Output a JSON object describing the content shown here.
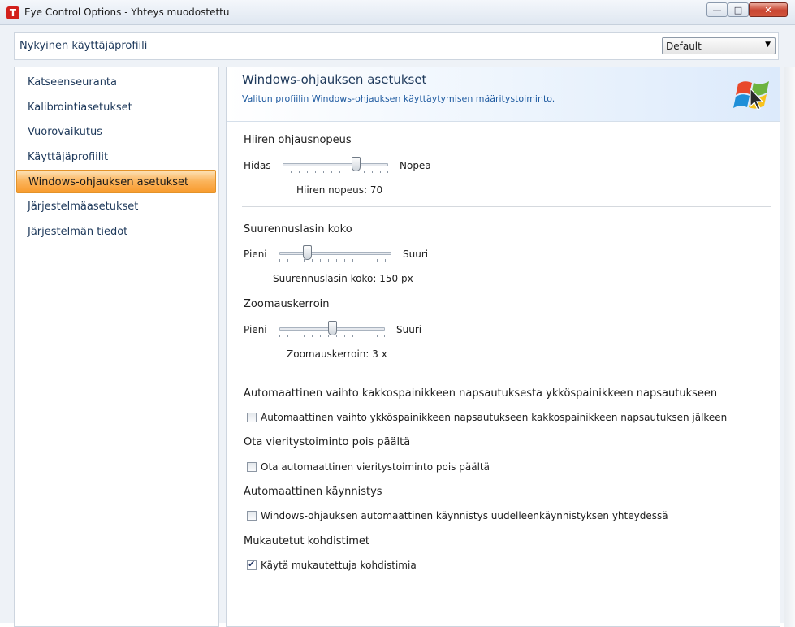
{
  "window": {
    "title": "Eye Control Options - Yhteys muodostettu",
    "app_icon_letter": "T",
    "controls": {
      "minimize": "—",
      "maximize": "□",
      "close": "✕"
    }
  },
  "profile": {
    "label": "Nykyinen käyttäjäprofiili",
    "selected": "Default"
  },
  "sidebar": {
    "items": [
      {
        "label": "Katseenseuranta"
      },
      {
        "label": "Kalibrointiasetukset"
      },
      {
        "label": "Vuorovaikutus"
      },
      {
        "label": "Käyttäjäprofiilit"
      },
      {
        "label": "Windows-ohjauksen asetukset",
        "active": true
      },
      {
        "label": "Järjestelmäasetukset"
      },
      {
        "label": "Järjestelmän tiedot"
      }
    ]
  },
  "main": {
    "title": "Windows-ohjauksen asetukset",
    "subtitle": "Valitun profiilin Windows-ohjauksen käyttäytymisen määritystoiminto.",
    "mouse_speed": {
      "title": "Hiiren ohjausnopeus",
      "min_label": "Hidas",
      "max_label": "Nopea",
      "value_text": "Hiiren nopeus: 70",
      "value": 70
    },
    "magnifier": {
      "title": "Suurennuslasin koko",
      "min_label": "Pieni",
      "max_label": "Suuri",
      "value_text": "Suurennuslasin koko: 150 px"
    },
    "zoom": {
      "title": "Zoomauskerroin",
      "min_label": "Pieni",
      "max_label": "Suuri",
      "value_text": "Zoomauskerroin: 3 x"
    },
    "auto_switch": {
      "title": "Automaattinen vaihto kakkospainikkeen napsautuksesta ykköspainikkeen napsautukseen",
      "option": "Automaattinen vaihto ykköspainikkeen napsautukseen kakkospainikkeen napsautuksen jälkeen",
      "checked": false
    },
    "scroll": {
      "title": "Ota vieritystoiminto pois päältä",
      "option": "Ota automaattinen vieritystoiminto pois päältä",
      "checked": false
    },
    "autostart": {
      "title": "Automaattinen käynnistys",
      "option": "Windows-ohjauksen automaattinen käynnistys uudelleenkäynnistyksen yhteydessä",
      "checked": false
    },
    "cursors": {
      "title": "Mukautetut kohdistimet",
      "option": "Käytä mukautettuja kohdistimia",
      "checked": true
    }
  }
}
